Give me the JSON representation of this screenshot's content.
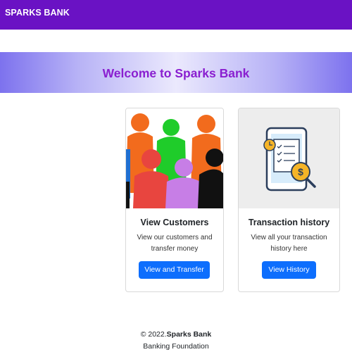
{
  "navbar": {
    "brand": "SPARKS BANK"
  },
  "hero": {
    "title": "Welcome to Sparks Bank"
  },
  "cards": [
    {
      "title": "View Customers",
      "text": "View our customers and transfer money",
      "button": "View and Transfer",
      "image": "people-group-illustration"
    },
    {
      "title": "Transaction history",
      "text": "View all your transaction history here",
      "button": "View History",
      "image": "phone-receipt-dollar-illustration"
    }
  ],
  "footer": {
    "copyright_prefix": "© 2022.",
    "copyright_name": "Sparks Bank",
    "tagline": "Banking Foundation"
  },
  "colors": {
    "navbar": "#6a12c4",
    "hero_title": "#8a1fd0",
    "button": "#0d6efd"
  }
}
